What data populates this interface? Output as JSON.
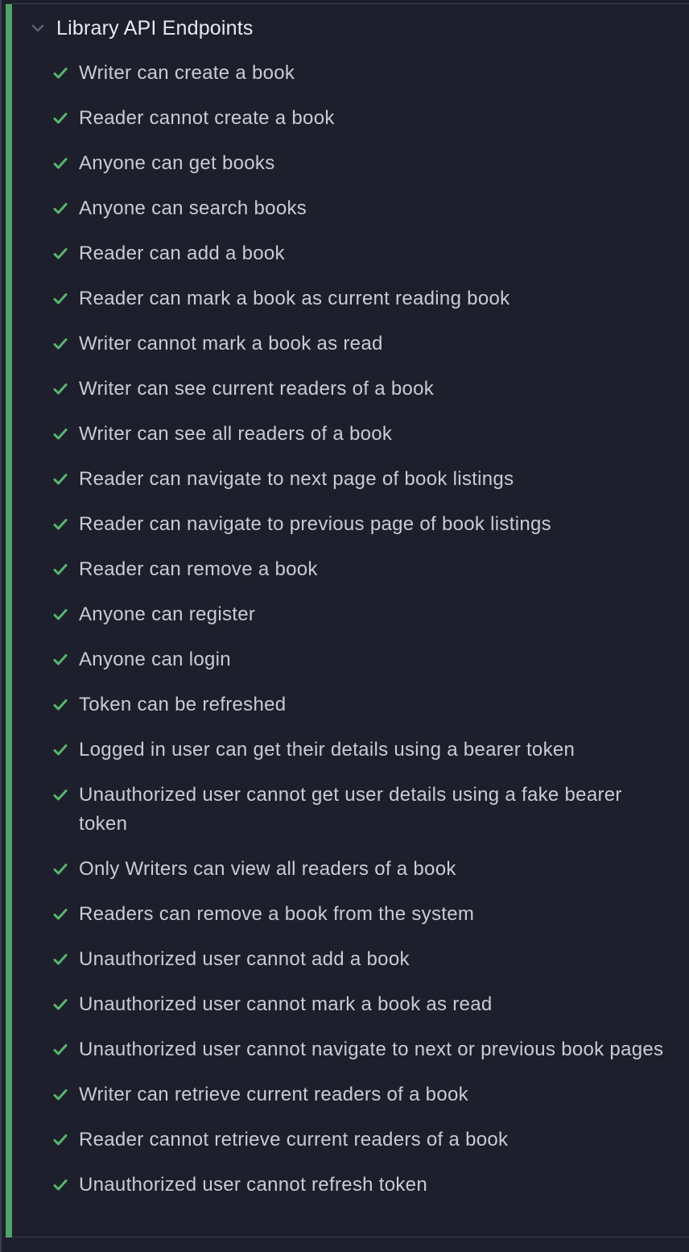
{
  "suite": {
    "title": "Library API Endpoints",
    "status": "passed",
    "collapse_icon": "chevron-down-icon",
    "colors": {
      "pass_bar": "#4ea46a",
      "check": "#57b66d",
      "title_text": "#e9e9ee",
      "test_text": "#c9cbd6",
      "background": "#1e1f2c"
    }
  },
  "tests": [
    {
      "label": "Writer can create a book",
      "status": "passed",
      "icon": "check-icon"
    },
    {
      "label": "Reader cannot create a book",
      "status": "passed",
      "icon": "check-icon"
    },
    {
      "label": "Anyone can get books",
      "status": "passed",
      "icon": "check-icon"
    },
    {
      "label": "Anyone can search books",
      "status": "passed",
      "icon": "check-icon"
    },
    {
      "label": "Reader can add a book",
      "status": "passed",
      "icon": "check-icon"
    },
    {
      "label": "Reader can mark a book as current reading book",
      "status": "passed",
      "icon": "check-icon"
    },
    {
      "label": "Writer cannot mark a book as read",
      "status": "passed",
      "icon": "check-icon"
    },
    {
      "label": "Writer can see current readers of a book",
      "status": "passed",
      "icon": "check-icon"
    },
    {
      "label": "Writer can see all readers of a book",
      "status": "passed",
      "icon": "check-icon"
    },
    {
      "label": "Reader can navigate to next page of book listings",
      "status": "passed",
      "icon": "check-icon"
    },
    {
      "label": "Reader can navigate to previous page of book listings",
      "status": "passed",
      "icon": "check-icon"
    },
    {
      "label": "Reader can remove a book",
      "status": "passed",
      "icon": "check-icon"
    },
    {
      "label": "Anyone can register",
      "status": "passed",
      "icon": "check-icon"
    },
    {
      "label": "Anyone can login",
      "status": "passed",
      "icon": "check-icon"
    },
    {
      "label": "Token can be refreshed",
      "status": "passed",
      "icon": "check-icon"
    },
    {
      "label": "Logged in user can get their details using a bearer token",
      "status": "passed",
      "icon": "check-icon"
    },
    {
      "label": "Unauthorized user cannot get user details using a fake bearer token",
      "status": "passed",
      "icon": "check-icon"
    },
    {
      "label": "Only Writers can view all readers of a book",
      "status": "passed",
      "icon": "check-icon"
    },
    {
      "label": "Readers can remove a book from the system",
      "status": "passed",
      "icon": "check-icon"
    },
    {
      "label": "Unauthorized user cannot add a book",
      "status": "passed",
      "icon": "check-icon"
    },
    {
      "label": "Unauthorized user cannot mark a book as read",
      "status": "passed",
      "icon": "check-icon"
    },
    {
      "label": "Unauthorized user cannot navigate to next or previous book pages",
      "status": "passed",
      "icon": "check-icon"
    },
    {
      "label": "Writer can retrieve current readers of a book",
      "status": "passed",
      "icon": "check-icon"
    },
    {
      "label": "Reader cannot retrieve current readers of a book",
      "status": "passed",
      "icon": "check-icon"
    },
    {
      "label": "Unauthorized user cannot refresh token",
      "status": "passed",
      "icon": "check-icon"
    }
  ]
}
